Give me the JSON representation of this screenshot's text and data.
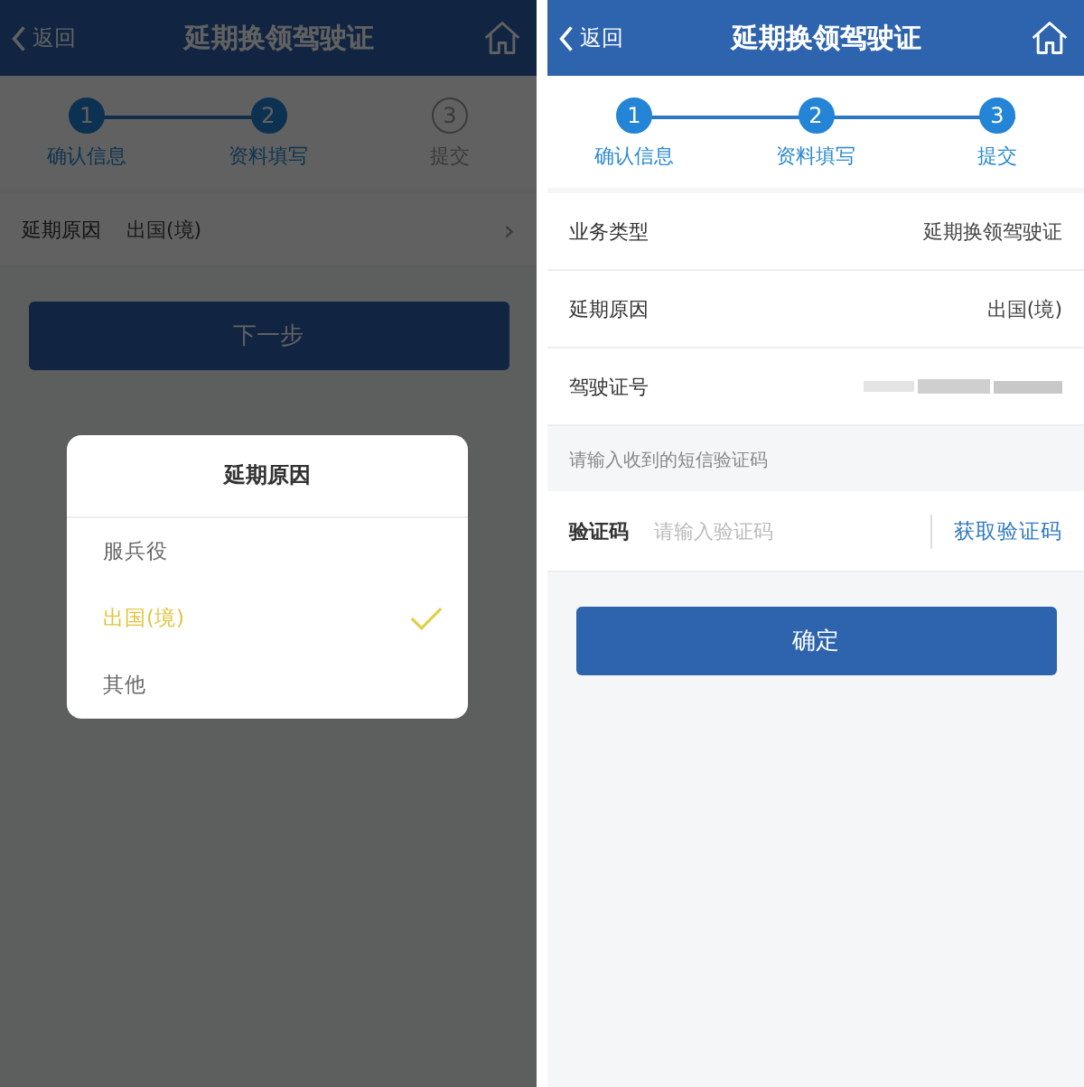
{
  "screens": [
    {
      "nav": {
        "back": "返回",
        "title": "延期换领驾驶证"
      },
      "steps": [
        {
          "number": "1",
          "label": "确认信息",
          "done": true
        },
        {
          "number": "2",
          "label": "资料填写",
          "done": true
        },
        {
          "number": "3",
          "label": "提交",
          "done": false
        }
      ],
      "rows": [
        {
          "kind": "select",
          "label": "延期原因",
          "value": "出国(境)",
          "chevron": "›"
        }
      ],
      "button": "下一步",
      "dialog": {
        "title": "延期原因",
        "options": [
          {
            "label": "服兵役",
            "selected": false
          },
          {
            "label": "出国(境)",
            "selected": true
          },
          {
            "label": "其他",
            "selected": false
          }
        ]
      }
    },
    {
      "nav": {
        "back": "返回",
        "title": "延期换领驾驶证"
      },
      "steps": [
        {
          "number": "1",
          "label": "确认信息",
          "done": true
        },
        {
          "number": "2",
          "label": "资料填写",
          "done": true
        },
        {
          "number": "3",
          "label": "提交",
          "done": true
        }
      ],
      "rows": [
        {
          "kind": "info",
          "label": "业务类型",
          "value": "延期换领驾驶证"
        },
        {
          "kind": "info",
          "label": "延期原因",
          "value": "出国(境)"
        },
        {
          "kind": "redacted",
          "label": "驾驶证号"
        },
        {
          "kind": "hint",
          "label": "请输入收到的短信验证码"
        },
        {
          "kind": "code",
          "label": "验证码",
          "placeholder": "请输入验证码",
          "action": "获取验证码"
        }
      ],
      "button": "确定"
    }
  ]
}
